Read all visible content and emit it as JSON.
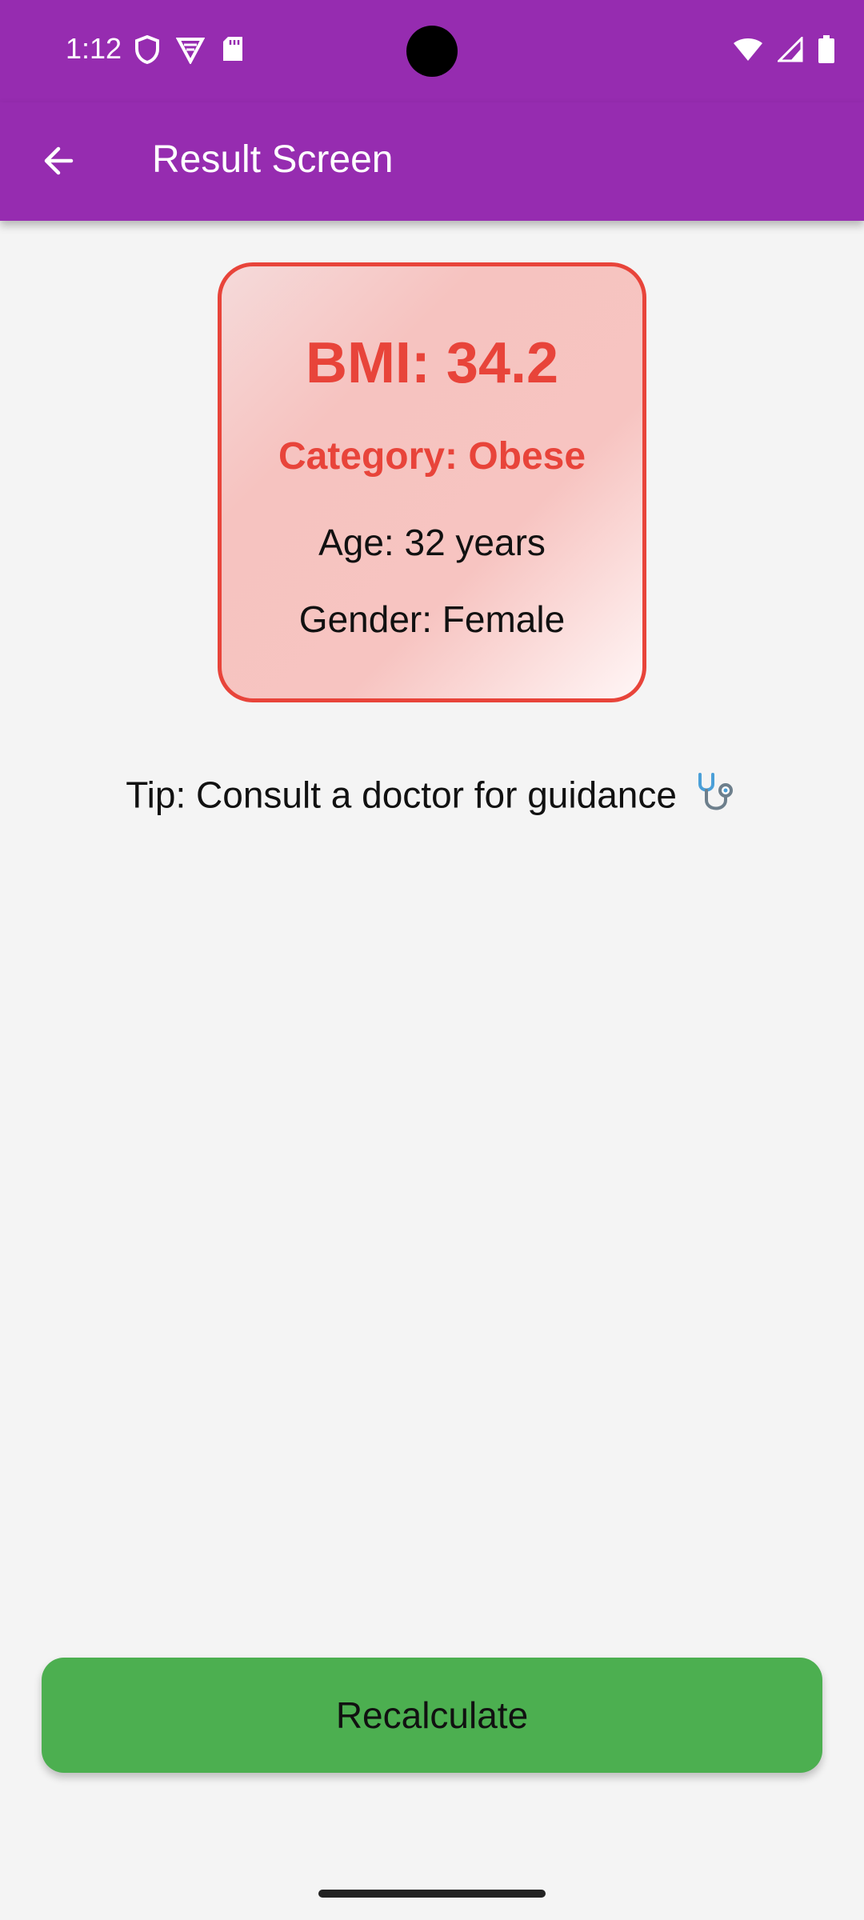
{
  "status_bar": {
    "time": "1:12",
    "left_icons": [
      "shield-icon",
      "vpn-icon",
      "sd-card-icon"
    ],
    "right_icons": [
      "wifi-icon",
      "cell-signal-icon",
      "battery-icon"
    ]
  },
  "app_bar": {
    "title": "Result Screen",
    "back_icon": "arrow-back-icon"
  },
  "result": {
    "bmi": "BMI: 34.2",
    "category": "Category: Obese",
    "age": "Age: 32 years",
    "gender": "Gender: Female"
  },
  "tip": {
    "text": "Tip: Consult a doctor for guidance",
    "icon": "stethoscope-icon"
  },
  "actions": {
    "recalculate": "Recalculate"
  },
  "colors": {
    "app_bar": "#962cb0",
    "accent_red": "#e8443a",
    "button_green": "#4caf50",
    "background": "#f4f4f4"
  }
}
